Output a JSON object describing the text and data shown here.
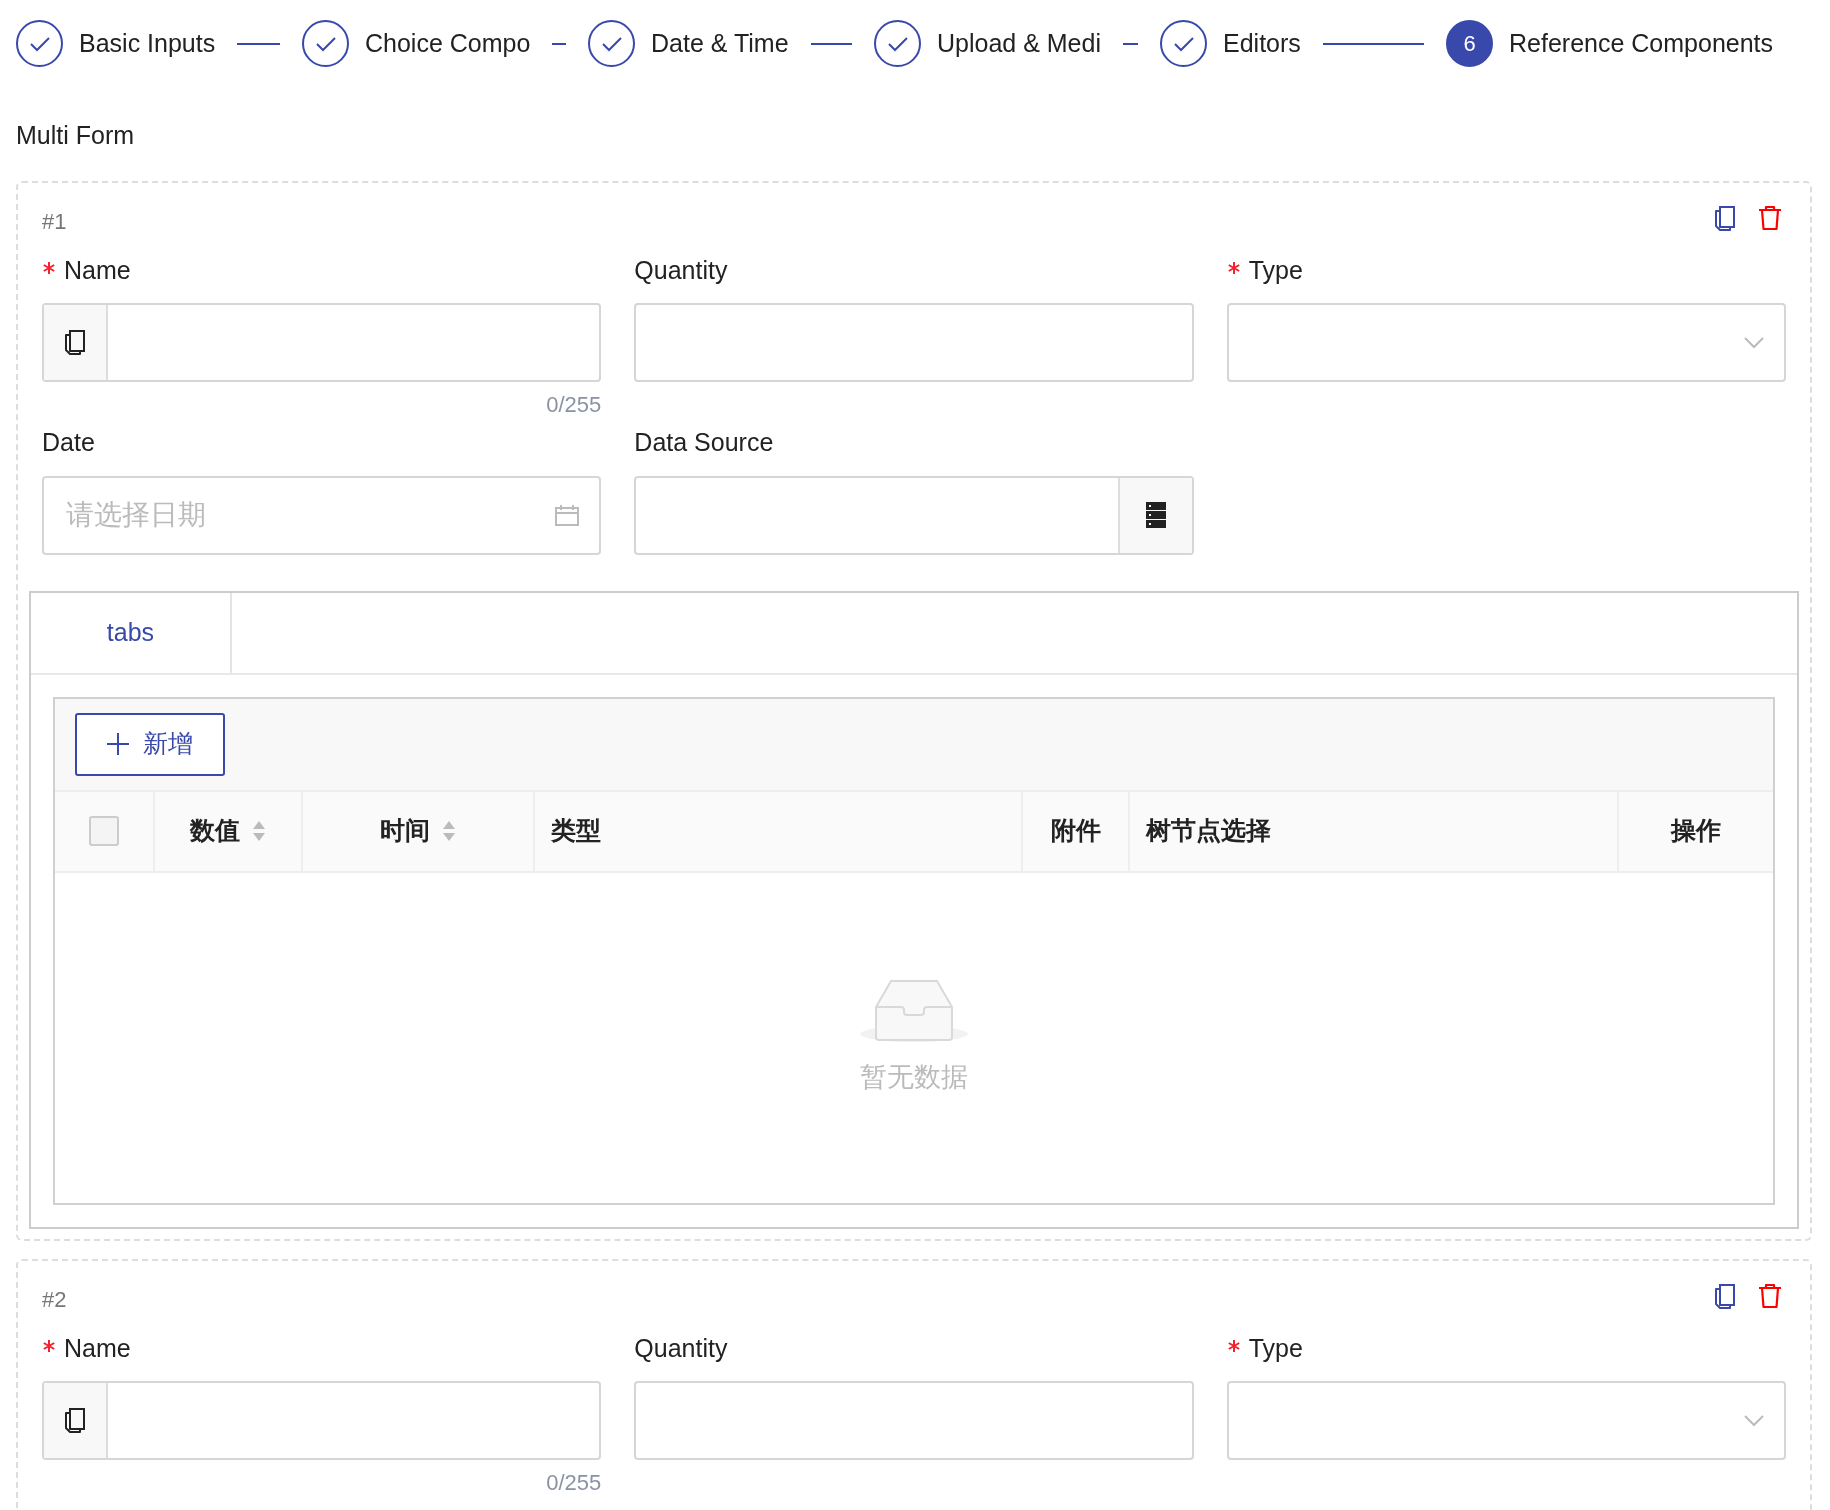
{
  "steps": [
    {
      "label": "Basic Inputs",
      "completed": true
    },
    {
      "label": "Choice Compo",
      "completed": true
    },
    {
      "label": "Date & Time",
      "completed": true
    },
    {
      "label": "Upload & Medi",
      "completed": true
    },
    {
      "label": "Editors",
      "completed": true
    },
    {
      "number": "6",
      "label": "Reference Components",
      "completed": false
    }
  ],
  "section_title": "Multi Form",
  "entries": [
    {
      "index": "#1",
      "fields": [
        {
          "kind": "text",
          "label": "Name",
          "required": true,
          "counter": "0/255"
        },
        {
          "kind": "number",
          "label": "Quantity",
          "required": false
        },
        {
          "kind": "select",
          "label": "Type",
          "required": true
        },
        {
          "kind": "date",
          "label": "Date",
          "required": false,
          "placeholder": "请选择日期"
        },
        {
          "kind": "lookup",
          "label": "Data Source",
          "required": false
        }
      ],
      "tabs": [
        {
          "label": "tabs",
          "selected": true
        }
      ],
      "table": {
        "add_button": "新增",
        "select_all_checked": false,
        "columns": [
          {
            "label": "数值",
            "sortable": true
          },
          {
            "label": "时间",
            "sortable": true
          },
          {
            "label": "类型",
            "sortable": false
          },
          {
            "label": "附件",
            "sortable": false
          },
          {
            "label": "树节点选择",
            "sortable": false
          },
          {
            "label": "操作",
            "sortable": false
          }
        ],
        "empty_text": "暂无数据"
      }
    },
    {
      "index": "#2",
      "fields": [
        {
          "kind": "text",
          "label": "Name",
          "required": true,
          "counter": "0/255"
        },
        {
          "kind": "number",
          "label": "Quantity",
          "required": false
        },
        {
          "kind": "select",
          "label": "Type",
          "required": true
        }
      ]
    }
  ]
}
